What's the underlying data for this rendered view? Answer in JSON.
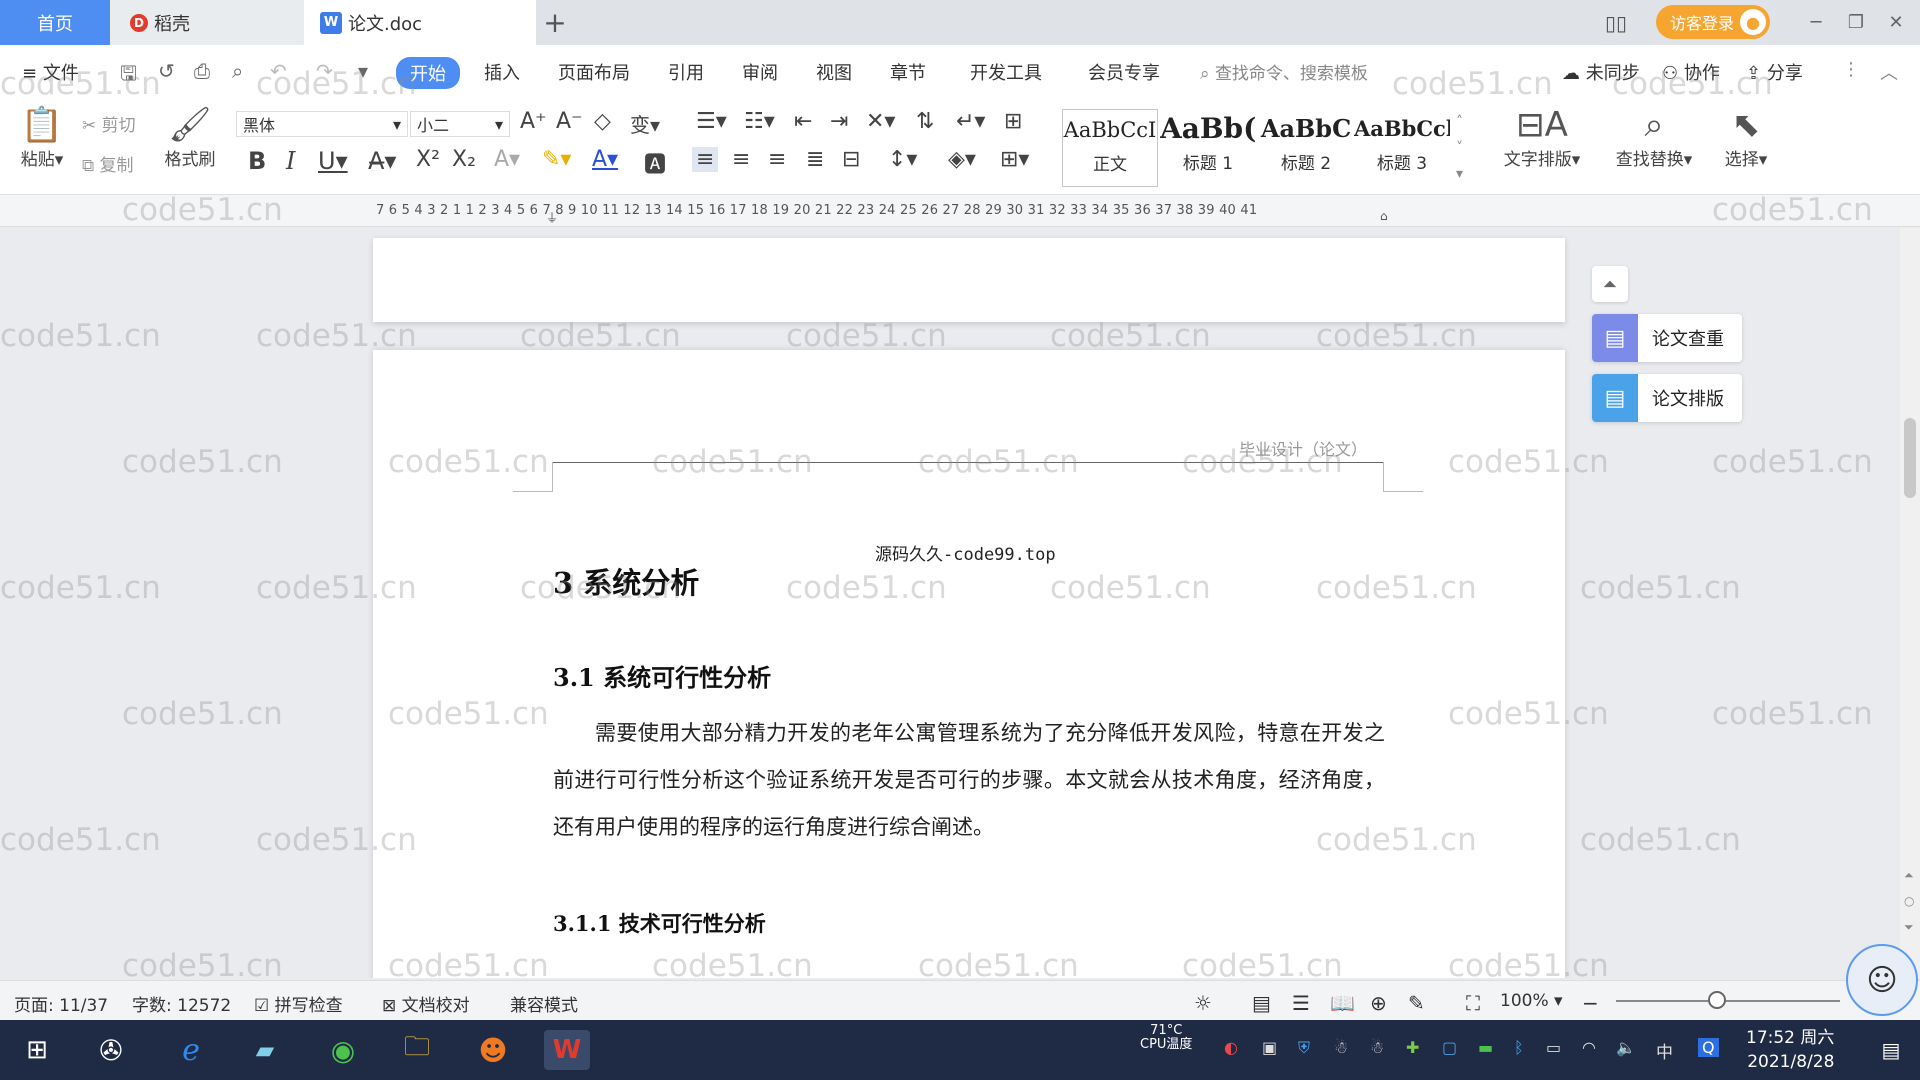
{
  "tabs": {
    "home": "首页",
    "daoke": "稻壳",
    "doc": "论文.doc",
    "add": "+"
  },
  "titlebar": {
    "login": "访客登录"
  },
  "menu": {
    "file": "文件",
    "items": [
      "开始",
      "插入",
      "页面布局",
      "引用",
      "审阅",
      "视图",
      "章节",
      "开发工具",
      "会员专享"
    ],
    "search_placeholder": "查找命令、搜索模板",
    "unsync": "未同步",
    "collab": "协作",
    "share": "分享"
  },
  "ribbon": {
    "paste": "粘贴",
    "cut": "剪切",
    "copy": "复制",
    "format_painter": "格式刷",
    "font_name": "黑体",
    "font_size": "小二",
    "styles": [
      {
        "sample": "AaBbCcI",
        "name": "正文"
      },
      {
        "sample": "AaBb(",
        "name": "标题 1"
      },
      {
        "sample": "AaBbC",
        "name": "标题 2"
      },
      {
        "sample": "AaBbCcl",
        "name": "标题 3"
      }
    ],
    "text_layout": "文字排版",
    "find_replace": "查找替换",
    "select": "选择"
  },
  "ruler": {
    "scale": "7 6 5 4 3 2 1 1 2 3 4 5 6 7 8 9 10 11 12 13 14 15 16 17 18 19 20 21 22 23 24 25 26 27 28 29 30 31 32 33 34 35 36 37 38 39 40 41"
  },
  "document": {
    "header": "毕业设计（论文）",
    "source": "源码久久-code99.top",
    "h1": "3  系统分析",
    "h2": "3.1 系统可行性分析",
    "paragraph": "需要使用大部分精力开发的老年公寓管理系统为了充分降低开发风险，特意在开发之前进行可行性分析这个验证系统开发是否可行的步骤。本文就会从技术角度，经济角度，还有用户使用的程序的运行角度进行综合阐述。",
    "h3": "3.1.1  技术可行性分析"
  },
  "watermark": "code51.cn",
  "side_panel": {
    "check": "论文查重",
    "format": "论文排版"
  },
  "status": {
    "page": "页面: 11/37",
    "words": "字数: 12572",
    "spell": "拼写检查",
    "proof": "文档校对",
    "compat": "兼容模式",
    "zoom": "100%"
  },
  "taskbar": {
    "cpu_temp": "71°C",
    "cpu_label": "CPU温度",
    "ime": "中",
    "time": "17:52 周六",
    "date": "2021/8/28"
  }
}
